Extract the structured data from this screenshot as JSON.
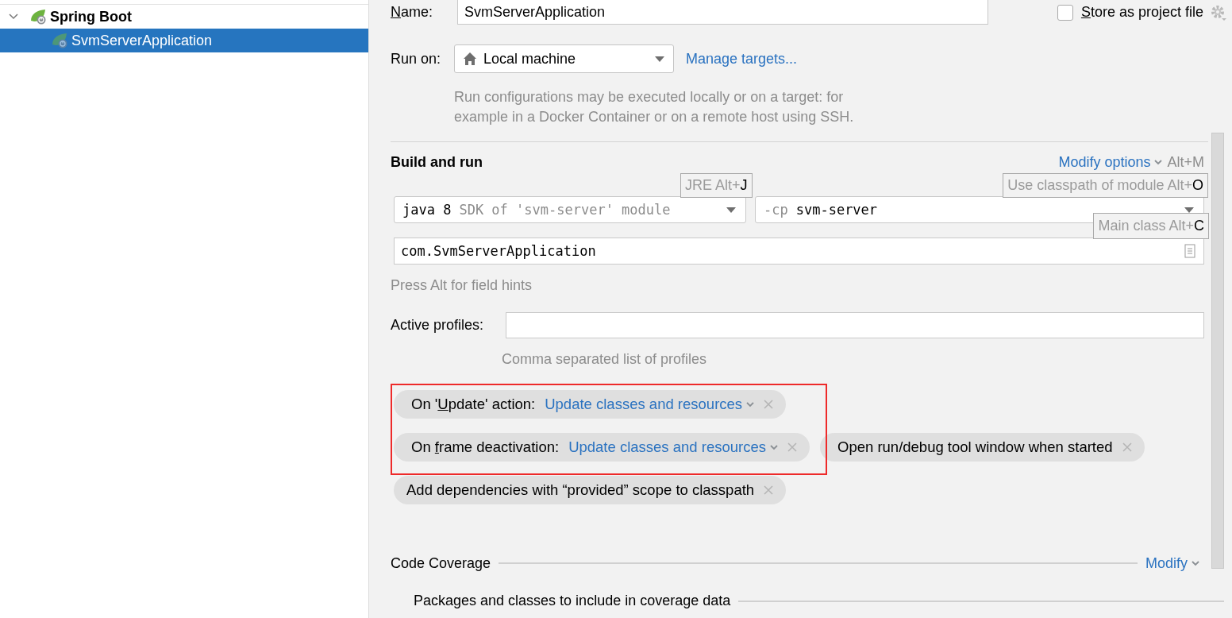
{
  "tree": {
    "label": "Spring Boot",
    "expanded": true,
    "children": [
      {
        "label": "SvmServerApplication",
        "selected": true
      }
    ]
  },
  "name_field": {
    "label": {
      "key": "N",
      "post": "ame:"
    },
    "value": "SvmServerApplication"
  },
  "store_as_project_file": {
    "label": {
      "key": "S",
      "post": "tore as project file"
    },
    "checked": false
  },
  "run_on": {
    "label": "Run on:",
    "value": "Local machine",
    "link": "Manage targets...",
    "help": [
      "Run configurations may be executed locally or on a target: for",
      "example in a Docker Container or on a remote host using SSH."
    ]
  },
  "build_and_run": {
    "title": "Build and run",
    "modify_link": "Modify options",
    "modify_shortcut": "Alt+M",
    "jre": {
      "value": "java 8",
      "hint": "SDK of 'svm-server' module"
    },
    "classpath": {
      "flag": "-cp",
      "value": "svm-server"
    },
    "main_class": "com.SvmServerApplication",
    "hint": "Press Alt for field hints",
    "tooltips": [
      {
        "kind": "jre",
        "text": "JRE Alt+",
        "key": "J"
      },
      {
        "kind": "classpath",
        "text": "Use classpath of module Alt+",
        "key": "O"
      },
      {
        "kind": "main",
        "text": "Main class Alt+",
        "key": "C"
      }
    ]
  },
  "active_profiles": {
    "label": "Active profiles:",
    "help": "Comma separated list of profiles"
  },
  "options": [
    [
      {
        "kind": "select",
        "label": {
          "pre": "On '",
          "key": "U",
          "post": "pdate' action:"
        },
        "value": "Update classes and resources"
      }
    ],
    [
      {
        "kind": "select",
        "label": {
          "pre": "On ",
          "key": "f",
          "post": "rame deactivation:"
        },
        "value": "Update classes and resources"
      },
      {
        "kind": "plain",
        "label": {
          "pre": "Open run/debug tool window when started"
        }
      }
    ],
    [
      {
        "kind": "plain",
        "label": {
          "pre": "Add dependencies with “provided” scope to classpath"
        }
      }
    ]
  ],
  "code_coverage": {
    "title": "Code Coverage",
    "modify_link": "Modify",
    "subsection": "Packages and classes to include in coverage data"
  }
}
